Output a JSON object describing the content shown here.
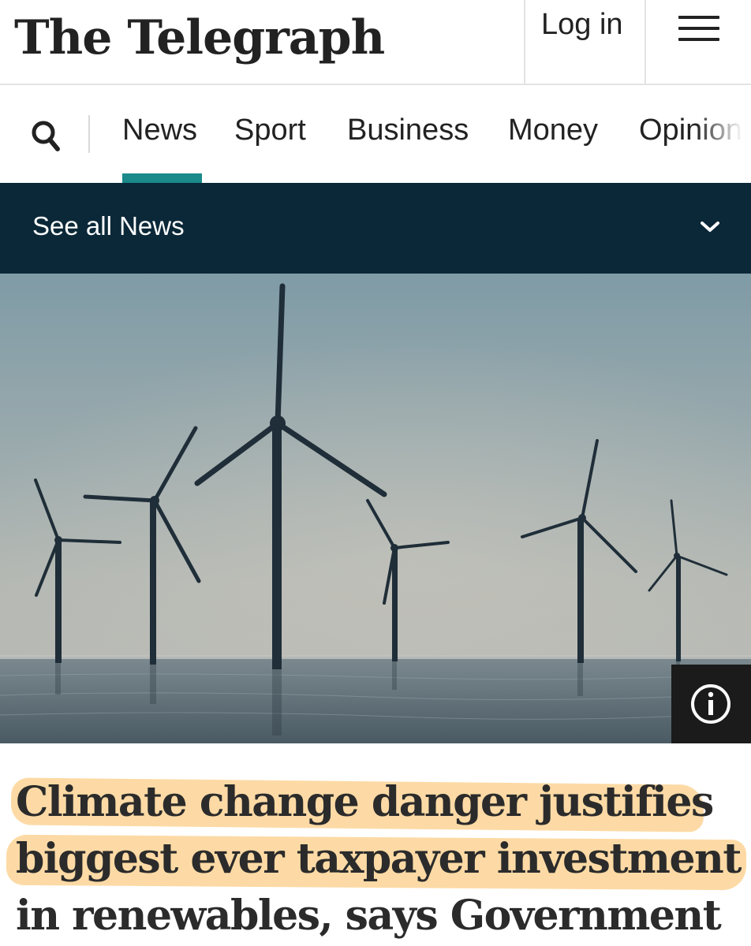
{
  "masthead": {
    "logo_text": "The Telegraph",
    "login_label": "Log in",
    "menu_icon": "hamburger-menu-icon"
  },
  "nav": {
    "search_icon": "search-icon",
    "items": [
      "News",
      "Sport",
      "Business",
      "Money",
      "Opinion"
    ],
    "active_item": "News",
    "accent_color": "#1a8a8a"
  },
  "subnav": {
    "label": "See all News",
    "chevron_icon": "chevron-down-icon",
    "background_color": "#0b2838"
  },
  "hero": {
    "info_icon": "info-icon"
  },
  "headline": {
    "lines": [
      "Climate change danger justifies",
      "biggest ever taxpayer investment",
      "in renewables, says Government"
    ],
    "highlight_color": "#fcc46e"
  }
}
